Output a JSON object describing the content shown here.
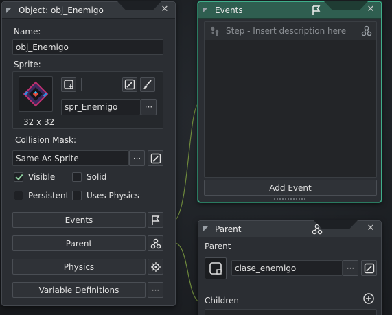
{
  "object_panel": {
    "title": "Object: obj_Enemigo",
    "name_label": "Name:",
    "name_value": "obj_Enemigo",
    "sprite_label": "Sprite:",
    "sprite_name": "spr_Enemigo",
    "sprite_size": "32 x 32",
    "collision_label": "Collision Mask:",
    "collision_value": "Same As Sprite",
    "visible_label": "Visible",
    "visible_checked": true,
    "solid_label": "Solid",
    "solid_checked": false,
    "persistent_label": "Persistent",
    "persistent_checked": false,
    "physics_label": "Uses Physics",
    "physics_checked": false,
    "events_button": "Events",
    "parent_button": "Parent",
    "physics_button": "Physics",
    "variables_button": "Variable Definitions"
  },
  "events_panel": {
    "title": "Events",
    "step_placeholder": "Step - Insert description here",
    "add_event_button": "Add Event",
    "accent": "#3fae8a"
  },
  "parent_panel": {
    "title": "Parent",
    "parent_label": "Parent",
    "parent_value": "clase_enemigo",
    "children_label": "Children"
  },
  "icons": {
    "close": "close-icon",
    "flag": "flag-icon",
    "hierarchy": "hierarchy-icon",
    "physics": "physics-icon",
    "edit": "edit-image-icon",
    "brush": "brush-icon",
    "new_sprite": "new-sprite-icon",
    "plus": "plus-circle-icon"
  }
}
